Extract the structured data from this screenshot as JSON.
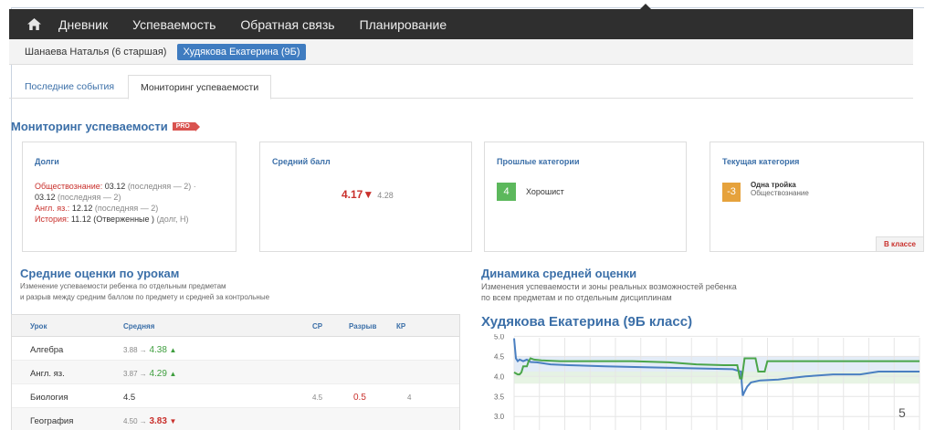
{
  "nav": {
    "items": [
      "Дневник",
      "Успеваемость",
      "Обратная связь",
      "Планирование"
    ]
  },
  "students": {
    "items": [
      "Шанаева Наталья (6 старшая)",
      "Худякова Екатерина (9Б)"
    ]
  },
  "tabs": {
    "items": [
      "Последние события",
      "Мониторинг успеваемости"
    ]
  },
  "page": {
    "title": "Мониторинг успеваемости",
    "pro_badge": "PRO"
  },
  "cards": {
    "debts": {
      "title": "Долги",
      "subject1": "Обществознание:",
      "subject1_date": " 03.12 ",
      "subject1_note": "(последняя — 2) ·",
      "subject1_cont": "03.12 ",
      "subject1_cont_note": "(последняя — 2)",
      "subject2": "Англ. яз.:",
      "subject2_date": " 12.12 ",
      "subject2_note": "(последняя — 2)",
      "subject3": "История:",
      "subject3_date": " 11.12 (Отверженные ) ",
      "subject3_note": "(долг, Н)"
    },
    "average": {
      "title": "Средний балл",
      "value": "4.17▼",
      "previous": "4.28"
    },
    "past": {
      "title": "Прошлые категории",
      "badge": "4",
      "name": "Хорошист"
    },
    "current": {
      "title": "Текущая категория",
      "badge": "-3",
      "name": "Одна тройка",
      "subject": "Обществознание",
      "link": "В классе"
    }
  },
  "lessons": {
    "title": "Средние оценки по урокам",
    "desc1": "Изменение успеваемости ребенка по отдельным предметам",
    "desc2": "и разрыв между средним баллом по предмету и средней за контрольные",
    "headers": [
      "Урок",
      "Средняя",
      "СР",
      "Разрыв",
      "КР"
    ],
    "rows": [
      {
        "subject": "Алгебра",
        "from": "3.88 →",
        "to": "4.38",
        "dir": "up",
        "cr": "",
        "gap": "",
        "kr": ""
      },
      {
        "subject": "Англ. яз.",
        "from": "3.87 →",
        "to": "4.29",
        "dir": "up",
        "cr": "",
        "gap": "",
        "kr": ""
      },
      {
        "subject": "Биология",
        "from": "",
        "to": "4.5",
        "dir": "none",
        "cr": "4.5",
        "gap": "0.5",
        "kr": "4"
      },
      {
        "subject": "География",
        "from": "4.50 →",
        "to": "3.83",
        "dir": "down",
        "cr": "",
        "gap": "",
        "kr": ""
      }
    ]
  },
  "dynamics": {
    "title": "Динамика средней оценки",
    "desc1": "Изменения успеваемости и зоны реальных возможностей ребенка",
    "desc2": "по всем предметам и по отдельным дисциплинам",
    "chart_title": "Худякова Екатерина (9Б класс)"
  },
  "chart_data": {
    "type": "line",
    "title": "Худякова Екатерина (9Б класс)",
    "y_ticks": [
      "5.0",
      "4.5",
      "4.0",
      "3.5",
      "3.0"
    ],
    "ylim": [
      2.8,
      5.1
    ],
    "grid": true,
    "series": [
      {
        "color": "#4a7fc1",
        "points": [
          [
            0,
            4.95
          ],
          [
            2,
            4.45
          ],
          [
            4,
            4.38
          ],
          [
            6,
            4.42
          ],
          [
            8,
            4.4
          ],
          [
            10,
            4.38
          ],
          [
            14,
            4.42
          ],
          [
            18,
            4.36
          ],
          [
            25,
            4.35
          ],
          [
            40,
            4.3
          ],
          [
            60,
            4.28
          ],
          [
            100,
            4.25
          ],
          [
            160,
            4.22
          ],
          [
            200,
            4.2
          ],
          [
            240,
            4.18
          ],
          [
            249,
            4.12
          ],
          [
            251,
            3.52
          ],
          [
            253,
            3.62
          ],
          [
            256,
            3.75
          ],
          [
            260,
            3.85
          ],
          [
            270,
            3.9
          ],
          [
            290,
            3.92
          ],
          [
            300,
            3.95
          ],
          [
            320,
            4.0
          ],
          [
            350,
            4.05
          ],
          [
            380,
            4.05
          ],
          [
            400,
            4.12
          ],
          [
            430,
            4.12
          ],
          [
            445,
            4.12
          ]
        ]
      },
      {
        "color": "#4aa54a",
        "points": [
          [
            0,
            4.1
          ],
          [
            4,
            4.05
          ],
          [
            6,
            4.05
          ],
          [
            8,
            4.1
          ],
          [
            10,
            4.25
          ],
          [
            14,
            4.25
          ],
          [
            16,
            4.38
          ],
          [
            18,
            4.45
          ],
          [
            22,
            4.42
          ],
          [
            30,
            4.4
          ],
          [
            50,
            4.38
          ],
          [
            80,
            4.38
          ],
          [
            130,
            4.38
          ],
          [
            170,
            4.35
          ],
          [
            200,
            4.3
          ],
          [
            230,
            4.28
          ],
          [
            245,
            4.28
          ],
          [
            248,
            3.95
          ],
          [
            250,
            3.95
          ],
          [
            253,
            4.45
          ],
          [
            265,
            4.45
          ],
          [
            268,
            4.12
          ],
          [
            275,
            4.12
          ],
          [
            278,
            4.38
          ],
          [
            300,
            4.38
          ],
          [
            350,
            4.38
          ],
          [
            400,
            4.38
          ],
          [
            445,
            4.38
          ]
        ]
      }
    ]
  },
  "footer": {
    "page_number": "5"
  }
}
